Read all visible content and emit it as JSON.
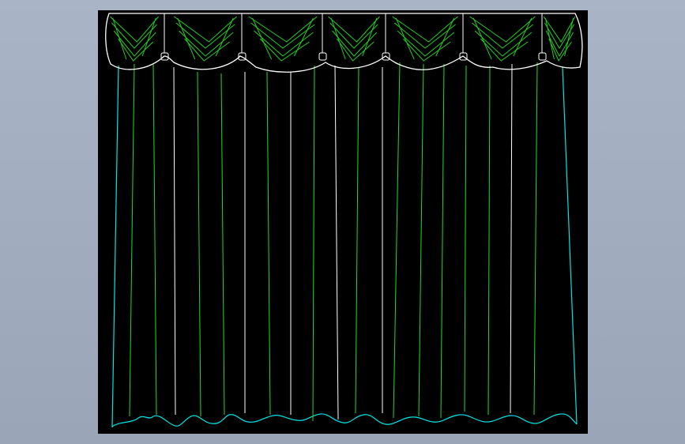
{
  "viewport": {
    "background_color": "#9aa5b8"
  },
  "drawing": {
    "subject": "curtain-with-swag-valance",
    "canvas_color": "#000000",
    "colors": {
      "valance_outline": "#ffffff",
      "valance_folds": "#22cc22",
      "panel_outline": "#00e5e5",
      "pleat_green": "#22dd22",
      "pleat_white": "#ffffff",
      "hem": "#00e5e5"
    },
    "swag_count": 6,
    "pleat_line_count": 18
  }
}
